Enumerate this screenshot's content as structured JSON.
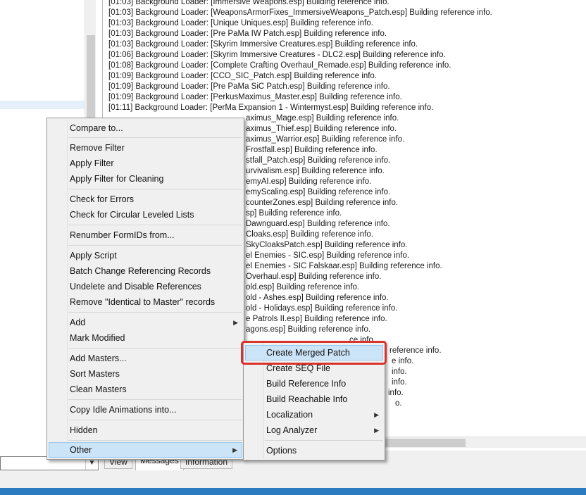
{
  "log": {
    "lines": [
      "[01:03] Background Loader: [Immersive Weapons.esp] Building reference info.",
      "[01:03] Background Loader: [WeaponsArmorFixes_ImmersiveWeapons_Patch.esp] Building reference info.",
      "[01:03] Background Loader: [Unique Uniques.esp] Building reference info.",
      "[01:03] Background Loader: [Pre PaMa IW Patch.esp] Building reference info.",
      "[01:03] Background Loader: [Skyrim Immersive Creatures.esp] Building reference info.",
      "[01:06] Background Loader: [Skyrim Immersive Creatures - DLC2.esp] Building reference info.",
      "[01:08] Background Loader: [Complete Crafting Overhaul_Remade.esp] Building reference info.",
      "[01:09] Background Loader: [CCO_SIC_Patch.esp] Building reference info.",
      "[01:09] Background Loader: [Pre PaMa SiC Patch.esp] Building reference info.",
      "[01:09] Background Loader: [PerkusMaximus_Master.esp] Building reference info.",
      "[01:11] Background Loader: [PerMa Expansion 1 - Wintermyst.esp] Building reference info."
    ],
    "visible_fragments": [
      "aximus_Mage.esp] Building reference info.",
      "aximus_Thief.esp] Building reference info.",
      "aximus_Warrior.esp] Building reference info.",
      "Frostfall.esp] Building reference info.",
      "stfall_Patch.esp] Building reference info.",
      "urvivalism.esp] Building reference info.",
      "emyAI.esp] Building reference info.",
      "emyScaling.esp] Building reference info.",
      "counterZones.esp] Building reference info.",
      "sp] Building reference info.",
      "Dawnguard.esp] Building reference info.",
      "Cloaks.esp] Building reference info.",
      "SkyCloaksPatch.esp] Building reference info.",
      "el Enemies - SIC.esp] Building reference info.",
      "el Enemies - SIC Falskaar.esp] Building reference info.",
      "Overhaul.esp] Building reference info.",
      "old.esp] Building reference info.",
      "old - Ashes.esp] Building reference info.",
      "old - Holidays.esp] Building reference info.",
      "e Patrols II.esp] Building reference info.",
      "agons.esp] Building reference info.",
      "ce info.",
      "reference info.",
      "e info.",
      "info.",
      "info.",
      "info.",
      "o."
    ]
  },
  "tabs": [
    "View",
    "Messages",
    "Information"
  ],
  "filter": {
    "dropdown_icon": "chevron-down-icon"
  },
  "main_menu": {
    "items": [
      "Compare to...",
      "Remove Filter",
      "Apply Filter",
      "Apply Filter for Cleaning",
      "Check for Errors",
      "Check for Circular Leveled Lists",
      "Renumber FormIDs from...",
      "Apply Script",
      "Batch Change Referencing Records",
      "Undelete and Disable References",
      "Remove \"Identical to Master\" records",
      "Add",
      "Mark Modified",
      "Add Masters...",
      "Sort Masters",
      "Clean Masters",
      "Copy Idle Animations into...",
      "Hidden",
      "Other"
    ]
  },
  "sub_menu": {
    "items": [
      "Create Merged Patch",
      "Create SEQ File",
      "Build Reference Info",
      "Build Reachable Info",
      "Localization",
      "Log Analyzer",
      "Options"
    ]
  },
  "colors": {
    "highlight_outline": "#d9342b",
    "menu_hover": "#cce4f7",
    "status_bar": "#2b7bc0"
  }
}
